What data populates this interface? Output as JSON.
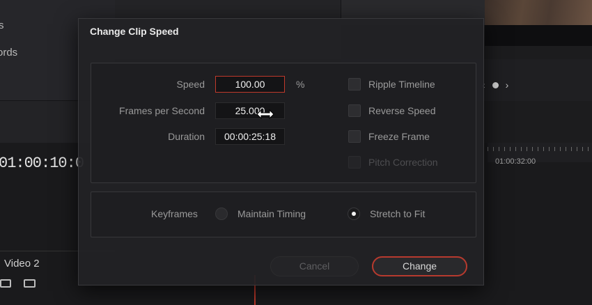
{
  "background": {
    "left_panel_fragment_1": "s",
    "left_panel_fragment_2": "ords",
    "timecode": "01:00:10:0",
    "ruler_timecode": "01:00:32:00",
    "track_label": "Video 2"
  },
  "dialog": {
    "title": "Change Clip Speed",
    "speed_label": "Speed",
    "speed_value": "100.00",
    "speed_unit": "%",
    "fps_label": "Frames per Second",
    "fps_value": "25.000",
    "duration_label": "Duration",
    "duration_value": "00:00:25:18",
    "ripple_timeline": "Ripple Timeline",
    "reverse_speed": "Reverse Speed",
    "freeze_frame": "Freeze Frame",
    "pitch_correction": "Pitch Correction",
    "keyframes_label": "Keyframes",
    "maintain_timing": "Maintain Timing",
    "stretch_to_fit": "Stretch to Fit",
    "cancel": "Cancel",
    "change": "Change"
  },
  "colors": {
    "accent": "#c0392b",
    "dialog_bg": "#222225"
  }
}
